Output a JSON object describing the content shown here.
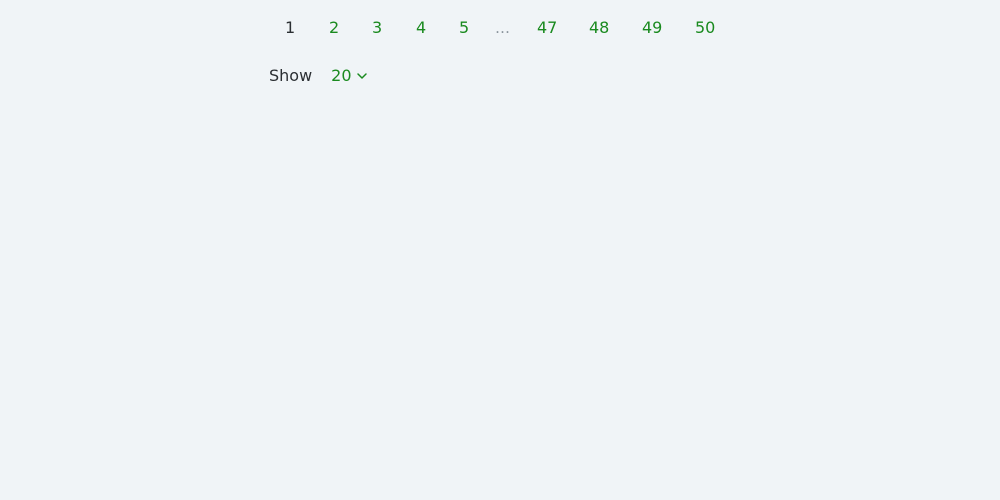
{
  "pagination": {
    "pages": [
      "1",
      "2",
      "3",
      "4",
      "5",
      "47",
      "48",
      "49",
      "50"
    ],
    "current_page": "1",
    "ellipsis": "…"
  },
  "page_size": {
    "label": "Show",
    "value": "20",
    "icon": "chevron-down-icon"
  },
  "colors": {
    "background": "#f0f4f7",
    "link": "#1a8a1f",
    "current": "#2b2f33",
    "ellipsis": "#8a949c"
  }
}
